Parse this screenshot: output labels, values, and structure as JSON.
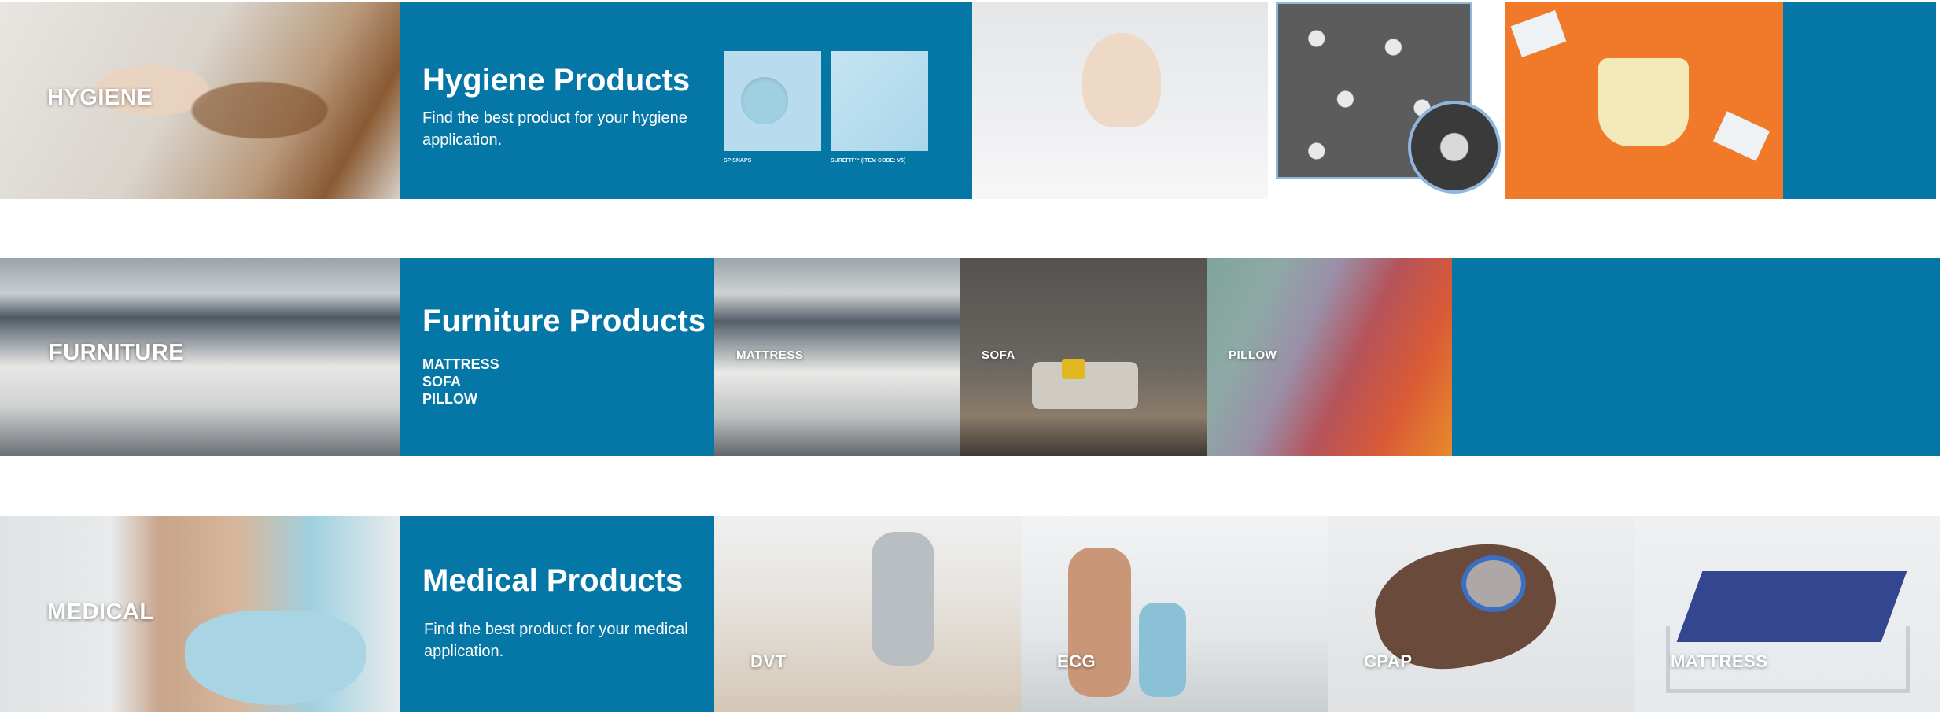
{
  "rows": [
    {
      "id": "hygiene",
      "category_label": "HYGIENE",
      "panel_title": "Hygiene Products",
      "panel_desc": "Find the best product for your hygiene application.",
      "swatches": [
        "SP SNAPS",
        "SUREFIT™ (ITEM CODE: V5)"
      ]
    },
    {
      "id": "furniture",
      "category_label": "FURNITURE",
      "panel_title": "Furniture Products",
      "panel_list": [
        "MATTRESS",
        "SOFA",
        "PILLOW"
      ],
      "tiles": [
        "MATTRESS",
        "SOFA",
        "PILLOW"
      ]
    },
    {
      "id": "medical",
      "category_label": "MEDICAL",
      "panel_title": "Medical Products",
      "panel_desc": "Find the best product for your medical application.",
      "tiles": [
        "DVT",
        "ECG",
        "CPAP",
        "MATTRESS"
      ]
    }
  ],
  "colors": {
    "brand_blue": "#0577a6",
    "accent_orange": "#f07a2a",
    "white": "#ffffff"
  }
}
